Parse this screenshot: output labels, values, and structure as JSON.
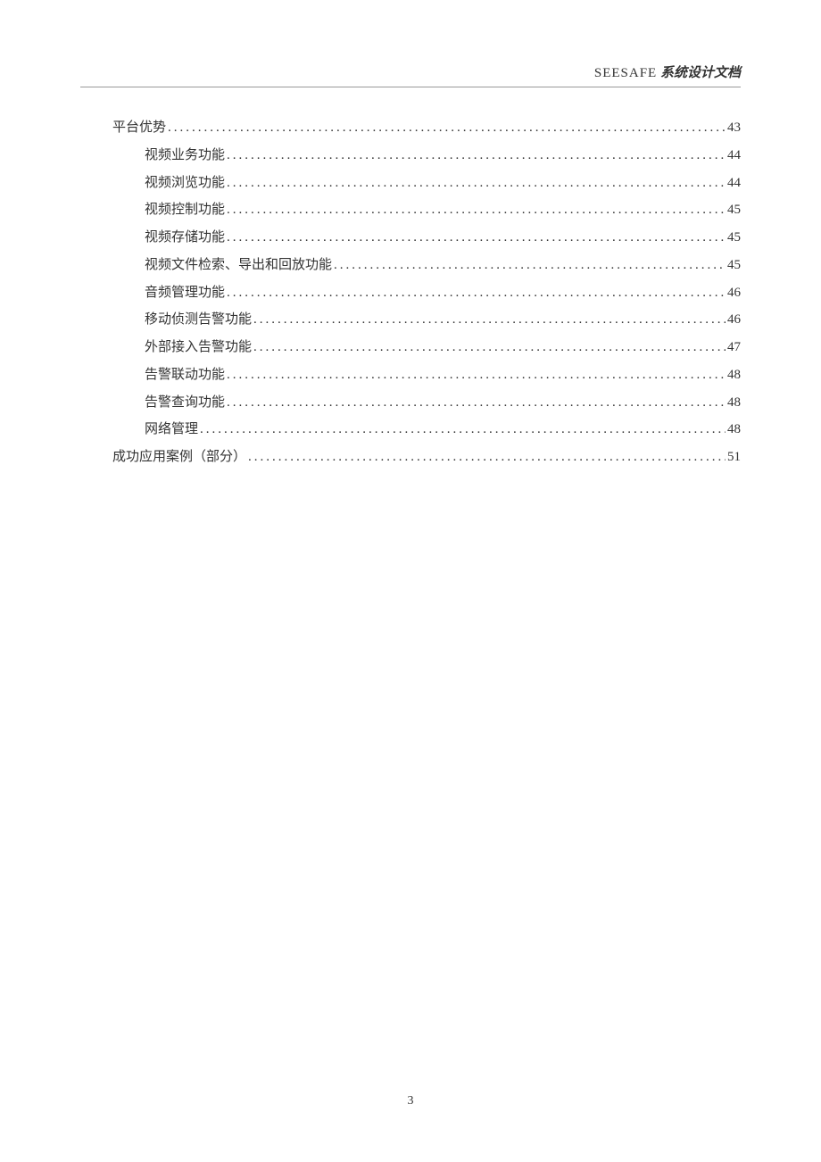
{
  "header": {
    "brand": "SEESAFE",
    "doc_title": "系统设计文档"
  },
  "toc": [
    {
      "level": 1,
      "title": "平台优势",
      "page": "43"
    },
    {
      "level": 2,
      "title": "视频业务功能",
      "page": "44"
    },
    {
      "level": 2,
      "title": "视频浏览功能",
      "page": "44"
    },
    {
      "level": 2,
      "title": "视频控制功能",
      "page": "45"
    },
    {
      "level": 2,
      "title": "视频存储功能",
      "page": "45"
    },
    {
      "level": 2,
      "title": "视频文件检索、导出和回放功能",
      "page": "45"
    },
    {
      "level": 2,
      "title": "音频管理功能",
      "page": "46"
    },
    {
      "level": 2,
      "title": "移动侦测告警功能",
      "page": "46"
    },
    {
      "level": 2,
      "title": "外部接入告警功能",
      "page": "47"
    },
    {
      "level": 2,
      "title": "告警联动功能",
      "page": "48"
    },
    {
      "level": 2,
      "title": "告警查询功能",
      "page": "48"
    },
    {
      "level": 2,
      "title": "网络管理",
      "page": "48"
    },
    {
      "level": 1,
      "title": "成功应用案例（部分）",
      "page": "51"
    }
  ],
  "page_number": "3"
}
